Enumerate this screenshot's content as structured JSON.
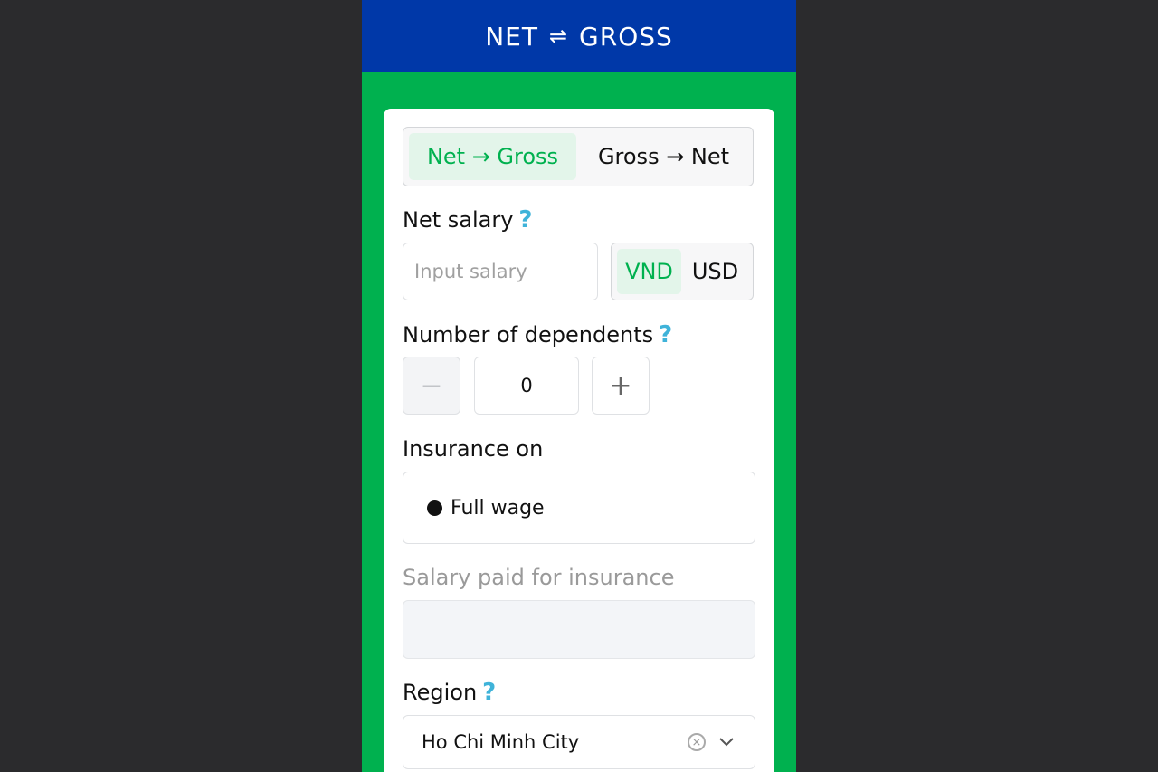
{
  "header": {
    "left": "NET",
    "swap_icon": "⇌",
    "right": "GROSS"
  },
  "mode": {
    "options": [
      "Net → Gross",
      "Gross → Net"
    ],
    "selected": "Net → Gross"
  },
  "net_salary": {
    "label": "Net salary",
    "help_icon": "?",
    "placeholder": "Input salary",
    "value": ""
  },
  "currency": {
    "options": [
      "VND",
      "USD"
    ],
    "selected": "VND"
  },
  "dependents": {
    "label": "Number of dependents",
    "help_icon": "?",
    "minus": "−",
    "value": "0",
    "plus": "+"
  },
  "insurance": {
    "label": "Insurance on",
    "option": "Full wage"
  },
  "insurance_salary": {
    "label": "Salary paid for insurance",
    "value": ""
  },
  "region": {
    "label": "Region",
    "help_icon": "?",
    "value": "Ho Chi Minh City",
    "clear_icon": "×"
  },
  "colors": {
    "header_bg": "#0038a8",
    "page_bg": "#00b14f",
    "accent": "#00b14f",
    "help": "#3fb3d9"
  }
}
